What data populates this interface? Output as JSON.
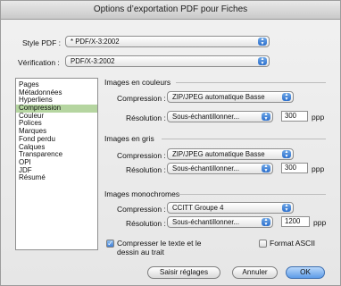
{
  "window": {
    "title": "Options d’exportation PDF pour Fiches"
  },
  "top": {
    "style_label": "Style PDF :",
    "style_value": "* PDF/X-3:2002",
    "verif_label": "Vérification :",
    "verif_value": "PDF/X-3:2002"
  },
  "sidebar": {
    "items": [
      {
        "label": "Pages"
      },
      {
        "label": "Métadonnées"
      },
      {
        "label": "Hyperliens"
      },
      {
        "label": "Compression"
      },
      {
        "label": "Couleur"
      },
      {
        "label": "Polices"
      },
      {
        "label": "Marques"
      },
      {
        "label": "Fond perdu"
      },
      {
        "label": "Calques"
      },
      {
        "label": "Transparence"
      },
      {
        "label": "OPI"
      },
      {
        "label": "JDF"
      },
      {
        "label": "Résumé"
      }
    ],
    "selected_index": 3
  },
  "color_images": {
    "title": "Images en couleurs",
    "compression_label": "Compression :",
    "compression_value": "ZIP/JPEG automatique Basse",
    "resolution_label": "Résolution :",
    "resolution_value": "Sous-échantillonner...",
    "dpi": "300",
    "unit": "ppp"
  },
  "gray_images": {
    "title": "Images en gris",
    "compression_label": "Compression :",
    "compression_value": "ZIP/JPEG automatique Basse",
    "resolution_label": "Résolution :",
    "resolution_value": "Sous-échantillonner...",
    "dpi": "300",
    "unit": "ppp"
  },
  "mono_images": {
    "title": "Images monochromes",
    "compression_label": "Compression :",
    "compression_value": "CCITT Groupe 4",
    "resolution_label": "Résolution :",
    "resolution_value": "Sous-échantillonner...",
    "dpi": "1200",
    "unit": "ppp"
  },
  "options": {
    "compress_text_line1": "Compresser le texte et le",
    "compress_text_line2": "dessin au trait",
    "compress_text_checked": true,
    "ascii_label": "Format ASCII",
    "ascii_checked": false
  },
  "buttons": {
    "save_settings": "Saisir réglages",
    "cancel": "Annuler",
    "ok": "OK"
  },
  "colors": {
    "selection": "#b5d5a0",
    "accent": "#2b6fcd"
  }
}
